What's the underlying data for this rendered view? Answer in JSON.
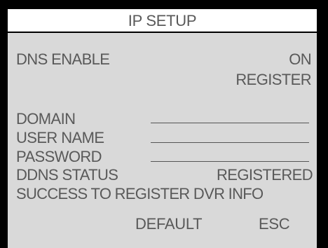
{
  "window": {
    "title": "IP SETUP"
  },
  "dns_enable": {
    "label": "DNS ENABLE",
    "value": "ON",
    "register_label": "REGISTER"
  },
  "fields": {
    "domain_label": "DOMAIN",
    "domain_value": "",
    "username_label": "USER NAME",
    "username_value": "",
    "password_label": "PASSWORD",
    "password_value": ""
  },
  "status": {
    "label": "DDNS STATUS",
    "value": "REGISTERED",
    "message": "SUCCESS TO REGISTER DVR INFO"
  },
  "buttons": {
    "default_label": "DEFAULT",
    "esc_label": "ESC"
  },
  "colors": {
    "background": "#d9d9d9",
    "text": "#595959",
    "title_bar": "#ffffff",
    "frame": "#000000"
  }
}
